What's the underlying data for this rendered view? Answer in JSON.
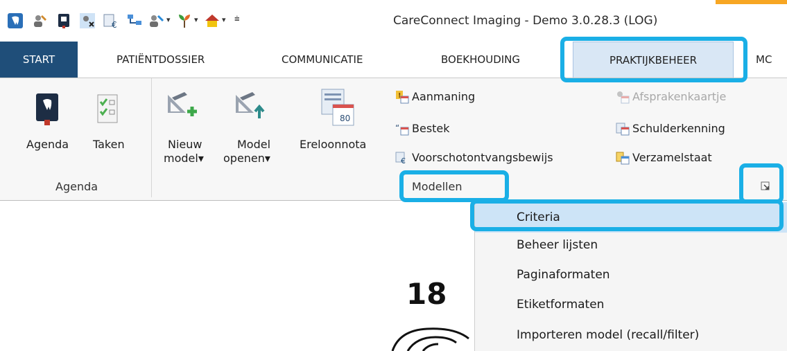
{
  "titlebar": {
    "app_title": "CareConnect Imaging - Demo 3.0.28.3 (LOG)",
    "qat_dropdown_glyph": "▾",
    "qat_customize_glyph": "⩧"
  },
  "tabs": [
    {
      "label": "START"
    },
    {
      "label": "PATIËNTDOSSIER"
    },
    {
      "label": "COMMUNICATIE"
    },
    {
      "label": "BOEKHOUDING"
    },
    {
      "label": "PRAKTIJKBEHEER"
    },
    {
      "label": "MC"
    }
  ],
  "ribbon": {
    "agenda_group": {
      "label": "Agenda",
      "agenda_button": "Agenda",
      "taken_button": "Taken"
    },
    "modellen_group": {
      "label": "Modellen",
      "nieuw_model_line1": "Nieuw",
      "nieuw_model_line2": "model▾",
      "model_openen_line1": "Model",
      "model_openen_line2": "openen▾",
      "ereloonnota": "Ereloonnota",
      "aanmaning": "Aanmaning",
      "bestek": "Bestek",
      "voorschotontvangsbewijs": "Voorschotontvangsbewijs",
      "afsprakenkaartje": "Afsprakenkaartje",
      "schulderkenning": "Schulderkenning",
      "verzamelstaat": "Verzamelstaat"
    }
  },
  "menu": {
    "items": [
      {
        "label": "Criteria"
      },
      {
        "label": "Beheer lijsten"
      },
      {
        "label": "Paginaformaten"
      },
      {
        "label": "Etiketformaten"
      },
      {
        "label": "Importeren model (recall/filter)"
      }
    ]
  },
  "content": {
    "tooth_number": "18"
  },
  "colors": {
    "start_tab": "#1f4e79",
    "active_tab": "#d9e7f5",
    "highlight_outline": "#1aafe6",
    "menu_hover": "#cde4f7",
    "title_accent": "#f7a623"
  }
}
